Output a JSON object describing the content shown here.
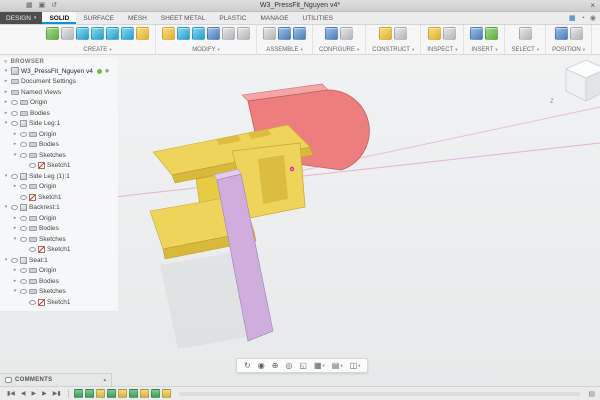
{
  "titlebar": {
    "title": "W3_PressFit_Nguyen v4*",
    "close_icon": "×"
  },
  "ribbon": {
    "design_menu": "DESIGN",
    "tabs": [
      {
        "label": "SOLID",
        "active": true
      },
      {
        "label": "SURFACE",
        "active": false
      },
      {
        "label": "MESH",
        "active": false
      },
      {
        "label": "SHEET METAL",
        "active": false
      },
      {
        "label": "PLASTIC",
        "active": false
      },
      {
        "label": "MANAGE",
        "active": false
      },
      {
        "label": "UTILITIES",
        "active": false
      }
    ],
    "groups": [
      {
        "label": "CREATE",
        "icons": [
          {
            "name": "new-component",
            "tone": "green"
          },
          {
            "name": "create-sketch",
            "tone": "gray"
          },
          {
            "name": "extrude",
            "tone": "cyan"
          },
          {
            "name": "revolve",
            "tone": "cyan"
          },
          {
            "name": "sweep",
            "tone": "cyan"
          },
          {
            "name": "loft",
            "tone": "cyan"
          },
          {
            "name": "hole",
            "tone": "yellow"
          }
        ]
      },
      {
        "label": "MODIFY",
        "icons": [
          {
            "name": "press-pull",
            "tone": "yellow"
          },
          {
            "name": "fillet",
            "tone": "cyan"
          },
          {
            "name": "shell",
            "tone": "cyan"
          },
          {
            "name": "combine",
            "tone": "blue"
          },
          {
            "name": "split-body",
            "tone": "gray"
          },
          {
            "name": "change-parameters",
            "tone": "gray"
          }
        ]
      },
      {
        "label": "ASSEMBLE",
        "icons": [
          {
            "name": "assemble-new-component",
            "tone": "gray"
          },
          {
            "name": "joint",
            "tone": "blue"
          },
          {
            "name": "rigid-group",
            "tone": "blue"
          }
        ]
      },
      {
        "label": "CONFIGURE",
        "icons": [
          {
            "name": "configuration",
            "tone": "blue"
          },
          {
            "name": "configuration-table",
            "tone": "gray"
          }
        ]
      },
      {
        "label": "CONSTRUCT",
        "icons": [
          {
            "name": "offset-plane",
            "tone": "yellow"
          },
          {
            "name": "construction-axis",
            "tone": "gray"
          }
        ]
      },
      {
        "label": "INSPECT",
        "icons": [
          {
            "name": "measure",
            "tone": "yellow"
          },
          {
            "name": "section-analysis",
            "tone": "gray"
          }
        ]
      },
      {
        "label": "INSERT",
        "icons": [
          {
            "name": "insert-derive",
            "tone": "blue"
          },
          {
            "name": "insert-svg",
            "tone": "green"
          }
        ]
      },
      {
        "label": "SELECT",
        "icons": [
          {
            "name": "select",
            "tone": "gray"
          }
        ]
      },
      {
        "label": "POSITION",
        "icons": [
          {
            "name": "capture-position",
            "tone": "blue"
          },
          {
            "name": "revert-position",
            "tone": "gray"
          }
        ]
      }
    ],
    "quick_icons": [
      "extensions",
      "job-status",
      "notifications"
    ]
  },
  "browser": {
    "header": "BROWSER",
    "root_label": "W3_PressFit_Nguyen v4",
    "items": [
      {
        "label": "Document Settings",
        "depth": 0,
        "icon": "folder",
        "arrow": "collapsed",
        "eye": false
      },
      {
        "label": "Named Views",
        "depth": 0,
        "icon": "folder",
        "arrow": "collapsed",
        "eye": false
      },
      {
        "label": "Origin",
        "depth": 0,
        "icon": "folder",
        "arrow": "collapsed",
        "eye": true
      },
      {
        "label": "Bodies",
        "depth": 0,
        "icon": "folder",
        "arrow": "collapsed",
        "eye": true
      },
      {
        "label": "Side Leg:1",
        "depth": 0,
        "icon": "component",
        "arrow": "expanded",
        "eye": true
      },
      {
        "label": "Origin",
        "depth": 1,
        "icon": "folder",
        "arrow": "collapsed",
        "eye": true
      },
      {
        "label": "Bodies",
        "depth": 1,
        "icon": "folder",
        "arrow": "collapsed",
        "eye": true
      },
      {
        "label": "Sketches",
        "depth": 1,
        "icon": "folder",
        "arrow": "expanded",
        "eye": true
      },
      {
        "label": "Sketch1",
        "depth": 2,
        "icon": "sketch",
        "arrow": "none",
        "eye": true
      },
      {
        "label": "Side Leg (1):1",
        "depth": 0,
        "icon": "component",
        "arrow": "expanded",
        "eye": true
      },
      {
        "label": "Origin",
        "depth": 1,
        "icon": "folder",
        "arrow": "collapsed",
        "eye": true
      },
      {
        "label": "Sketch1",
        "depth": 1,
        "icon": "sketch",
        "arrow": "none",
        "eye": true
      },
      {
        "label": "Backrest:1",
        "depth": 0,
        "icon": "component",
        "arrow": "expanded",
        "eye": true
      },
      {
        "label": "Origin",
        "depth": 1,
        "icon": "folder",
        "arrow": "collapsed",
        "eye": true
      },
      {
        "label": "Bodies",
        "depth": 1,
        "icon": "folder",
        "arrow": "collapsed",
        "eye": true
      },
      {
        "label": "Sketches",
        "depth": 1,
        "icon": "folder",
        "arrow": "expanded",
        "eye": true
      },
      {
        "label": "Sketch1",
        "depth": 2,
        "icon": "sketch",
        "arrow": "none",
        "eye": true
      },
      {
        "label": "Seat:1",
        "depth": 0,
        "icon": "component",
        "arrow": "expanded",
        "eye": true
      },
      {
        "label": "Origin",
        "depth": 1,
        "icon": "folder",
        "arrow": "collapsed",
        "eye": true
      },
      {
        "label": "Bodies",
        "depth": 1,
        "icon": "folder",
        "arrow": "collapsed",
        "eye": true
      },
      {
        "label": "Sketches",
        "depth": 1,
        "icon": "folder",
        "arrow": "expanded",
        "eye": true
      },
      {
        "label": "Sketch1",
        "depth": 2,
        "icon": "sketch",
        "arrow": "none",
        "eye": true
      }
    ]
  },
  "viewcube": {
    "axis_label": "Z"
  },
  "navbar": {
    "items": [
      {
        "name": "orbit",
        "caret": false
      },
      {
        "name": "look-at",
        "caret": false
      },
      {
        "name": "pan",
        "caret": false
      },
      {
        "name": "zoom",
        "caret": false
      },
      {
        "name": "fit",
        "caret": false
      },
      {
        "name": "display-settings",
        "caret": true
      },
      {
        "name": "grid-display",
        "caret": true
      },
      {
        "name": "viewports",
        "caret": true
      }
    ]
  },
  "comments": {
    "header": "COMMENTS"
  },
  "timeline": {
    "controls": [
      {
        "name": "go-to-start",
        "glyph": "▮◀"
      },
      {
        "name": "step-back",
        "glyph": "◀"
      },
      {
        "name": "play",
        "glyph": "▶"
      },
      {
        "name": "step-forward",
        "glyph": "▶"
      },
      {
        "name": "go-to-end",
        "glyph": "▶▮"
      }
    ],
    "features": [
      "sketch",
      "sketch",
      "component",
      "sketch",
      "component",
      "sketch",
      "component",
      "sketch",
      "component"
    ]
  },
  "colors": {
    "accent_blue": "#0696d7",
    "model_yellow": "#efd45c",
    "model_yellow_dark": "#d9b93a",
    "model_red": "#ee7e7e",
    "model_red_light": "#f4a6a6",
    "model_purple": "#cfaede",
    "model_purple_light": "#e2cdf0",
    "construction_pink": "#e473b8"
  }
}
